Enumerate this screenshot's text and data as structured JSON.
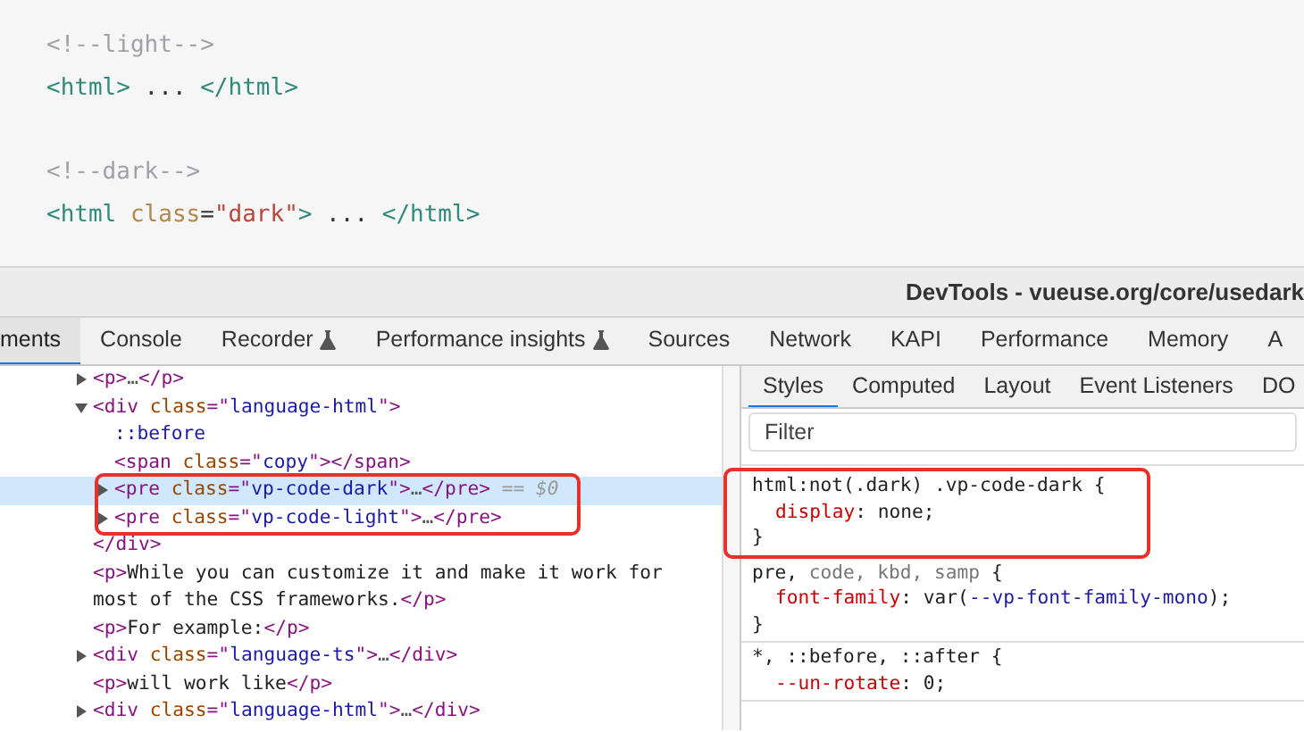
{
  "code_block": {
    "groups": [
      [
        [
          {
            "kind": "comment",
            "text": "<!--light-->"
          }
        ],
        [
          {
            "kind": "tag",
            "text": "<html>"
          },
          {
            "kind": "text",
            "text": " ... "
          },
          {
            "kind": "tag",
            "text": "</html>"
          }
        ]
      ],
      [
        [
          {
            "kind": "comment",
            "text": "<!--dark-->"
          }
        ],
        [
          {
            "kind": "tag",
            "text": "<html"
          },
          {
            "kind": "attr",
            "text": " class"
          },
          {
            "kind": "text",
            "text": "="
          },
          {
            "kind": "string",
            "text": "\"dark\""
          },
          {
            "kind": "tag",
            "text": ">"
          },
          {
            "kind": "text",
            "text": " ... "
          },
          {
            "kind": "tag",
            "text": "</html>"
          }
        ]
      ]
    ]
  },
  "window": {
    "title": "DevTools - vueuse.org/core/usedark"
  },
  "tabs": [
    {
      "label": "ments",
      "selected": true,
      "experimental": false
    },
    {
      "label": "Console",
      "selected": false,
      "experimental": false
    },
    {
      "label": "Recorder",
      "selected": false,
      "experimental": true
    },
    {
      "label": "Performance insights",
      "selected": false,
      "experimental": true
    },
    {
      "label": "Sources",
      "selected": false,
      "experimental": false
    },
    {
      "label": "Network",
      "selected": false,
      "experimental": false
    },
    {
      "label": "KAPI",
      "selected": false,
      "experimental": false
    },
    {
      "label": "Performance",
      "selected": false,
      "experimental": false
    },
    {
      "label": "Memory",
      "selected": false,
      "experimental": false
    },
    {
      "label": "A",
      "selected": false,
      "experimental": false
    }
  ],
  "elements": {
    "nodes": [
      {
        "tokens": [
          {
            "kind": "tag",
            "text": "<p>"
          },
          {
            "kind": "dim",
            "text": "…"
          },
          {
            "kind": "tag",
            "text": "</p>"
          }
        ],
        "expanded": false,
        "selected": false,
        "annotated": false
      },
      {
        "tokens": [
          {
            "kind": "tag",
            "text": "<div"
          },
          {
            "kind": "attr",
            "text": " class"
          },
          {
            "kind": "tag",
            "text": "=\""
          },
          {
            "kind": "string",
            "text": "language-html"
          },
          {
            "kind": "tag",
            "text": "\">"
          }
        ],
        "expanded": true,
        "selected": false,
        "annotated": false,
        "children": [
          {
            "tokens": [
              {
                "kind": "pseudo",
                "text": "::before"
              }
            ],
            "selected": false,
            "annotated": false
          },
          {
            "tokens": [
              {
                "kind": "tag",
                "text": "<span"
              },
              {
                "kind": "attr",
                "text": " class"
              },
              {
                "kind": "tag",
                "text": "=\""
              },
              {
                "kind": "string",
                "text": "copy"
              },
              {
                "kind": "tag",
                "text": "\"></span>"
              }
            ],
            "selected": false,
            "annotated": false
          },
          {
            "tokens": [
              {
                "kind": "tag",
                "text": "<pre"
              },
              {
                "kind": "attr",
                "text": " class"
              },
              {
                "kind": "tag",
                "text": "=\""
              },
              {
                "kind": "string",
                "text": "vp-code-dark"
              },
              {
                "kind": "tag",
                "text": "\">"
              },
              {
                "kind": "dim",
                "text": "…"
              },
              {
                "kind": "tag",
                "text": "</pre>"
              },
              {
                "kind": "ref",
                "text": " == $0"
              }
            ],
            "expanded": false,
            "selected": true,
            "annotated": true
          },
          {
            "tokens": [
              {
                "kind": "tag",
                "text": "<pre"
              },
              {
                "kind": "attr",
                "text": " class"
              },
              {
                "kind": "tag",
                "text": "=\""
              },
              {
                "kind": "string",
                "text": "vp-code-light"
              },
              {
                "kind": "tag",
                "text": "\">"
              },
              {
                "kind": "dim",
                "text": "…"
              },
              {
                "kind": "tag",
                "text": "</pre>"
              }
            ],
            "expanded": false,
            "selected": false,
            "annotated": true
          }
        ],
        "closing": [
          {
            "kind": "tag",
            "text": "</div>"
          }
        ]
      },
      {
        "tokens": [
          {
            "kind": "tag",
            "text": "<p>"
          },
          {
            "kind": "text",
            "text": "While you can customize it and make it work for most of the CSS frameworks."
          },
          {
            "kind": "tag",
            "text": "</p>"
          }
        ],
        "selected": false,
        "annotated": false
      },
      {
        "tokens": [
          {
            "kind": "tag",
            "text": "<p>"
          },
          {
            "kind": "text",
            "text": "For example:"
          },
          {
            "kind": "tag",
            "text": "</p>"
          }
        ],
        "selected": false,
        "annotated": false
      },
      {
        "tokens": [
          {
            "kind": "tag",
            "text": "<div"
          },
          {
            "kind": "attr",
            "text": " class"
          },
          {
            "kind": "tag",
            "text": "=\""
          },
          {
            "kind": "string",
            "text": "language-ts"
          },
          {
            "kind": "tag",
            "text": "\">"
          },
          {
            "kind": "dim",
            "text": "…"
          },
          {
            "kind": "tag",
            "text": "</div>"
          }
        ],
        "expanded": false,
        "selected": false,
        "annotated": false
      },
      {
        "tokens": [
          {
            "kind": "tag",
            "text": "<p>"
          },
          {
            "kind": "text",
            "text": "will work like"
          },
          {
            "kind": "tag",
            "text": "</p>"
          }
        ],
        "selected": false,
        "annotated": false
      },
      {
        "tokens": [
          {
            "kind": "tag",
            "text": "<div"
          },
          {
            "kind": "attr",
            "text": " class"
          },
          {
            "kind": "tag",
            "text": "=\""
          },
          {
            "kind": "string",
            "text": "language-html"
          },
          {
            "kind": "tag",
            "text": "\">"
          },
          {
            "kind": "dim",
            "text": "…"
          },
          {
            "kind": "tag",
            "text": "</div>"
          }
        ],
        "expanded": false,
        "selected": false,
        "annotated": false
      }
    ]
  },
  "styles": {
    "tabs": [
      {
        "label": "Styles",
        "selected": true
      },
      {
        "label": "Computed",
        "selected": false
      },
      {
        "label": "Layout",
        "selected": false
      },
      {
        "label": "Event Listeners",
        "selected": false
      },
      {
        "label": "DO",
        "selected": false
      }
    ],
    "filter": {
      "placeholder": "Filter"
    },
    "rules": [
      {
        "annotated": true,
        "lines": [
          {
            "kind": "selector",
            "tokens": [
              {
                "kind": "plain",
                "text": "html:not(.dark) .vp-code-dark {"
              }
            ]
          },
          {
            "kind": "declaration",
            "tokens": [
              {
                "kind": "property",
                "text": "display"
              },
              {
                "kind": "plain",
                "text": ": none;"
              }
            ]
          },
          {
            "kind": "close",
            "tokens": [
              {
                "kind": "plain",
                "text": "}"
              }
            ]
          }
        ]
      },
      {
        "annotated": false,
        "lines": [
          {
            "kind": "selector",
            "tokens": [
              {
                "kind": "plain",
                "text": "pre, "
              },
              {
                "kind": "dim",
                "text": "code, kbd, samp"
              },
              {
                "kind": "plain",
                "text": " {"
              }
            ]
          },
          {
            "kind": "declaration",
            "tokens": [
              {
                "kind": "property",
                "text": "font-family"
              },
              {
                "kind": "plain",
                "text": ": var("
              },
              {
                "kind": "variable",
                "text": "--vp-font-family-mono"
              },
              {
                "kind": "plain",
                "text": ");"
              }
            ]
          },
          {
            "kind": "close",
            "tokens": [
              {
                "kind": "plain",
                "text": "}"
              }
            ]
          }
        ]
      },
      {
        "annotated": false,
        "lines": [
          {
            "kind": "selector",
            "tokens": [
              {
                "kind": "plain",
                "text": "*, ::before, ::after {"
              }
            ]
          },
          {
            "kind": "declaration",
            "tokens": [
              {
                "kind": "property",
                "text": "--un-rotate"
              },
              {
                "kind": "plain",
                "text": ": 0;"
              }
            ]
          }
        ]
      }
    ]
  }
}
